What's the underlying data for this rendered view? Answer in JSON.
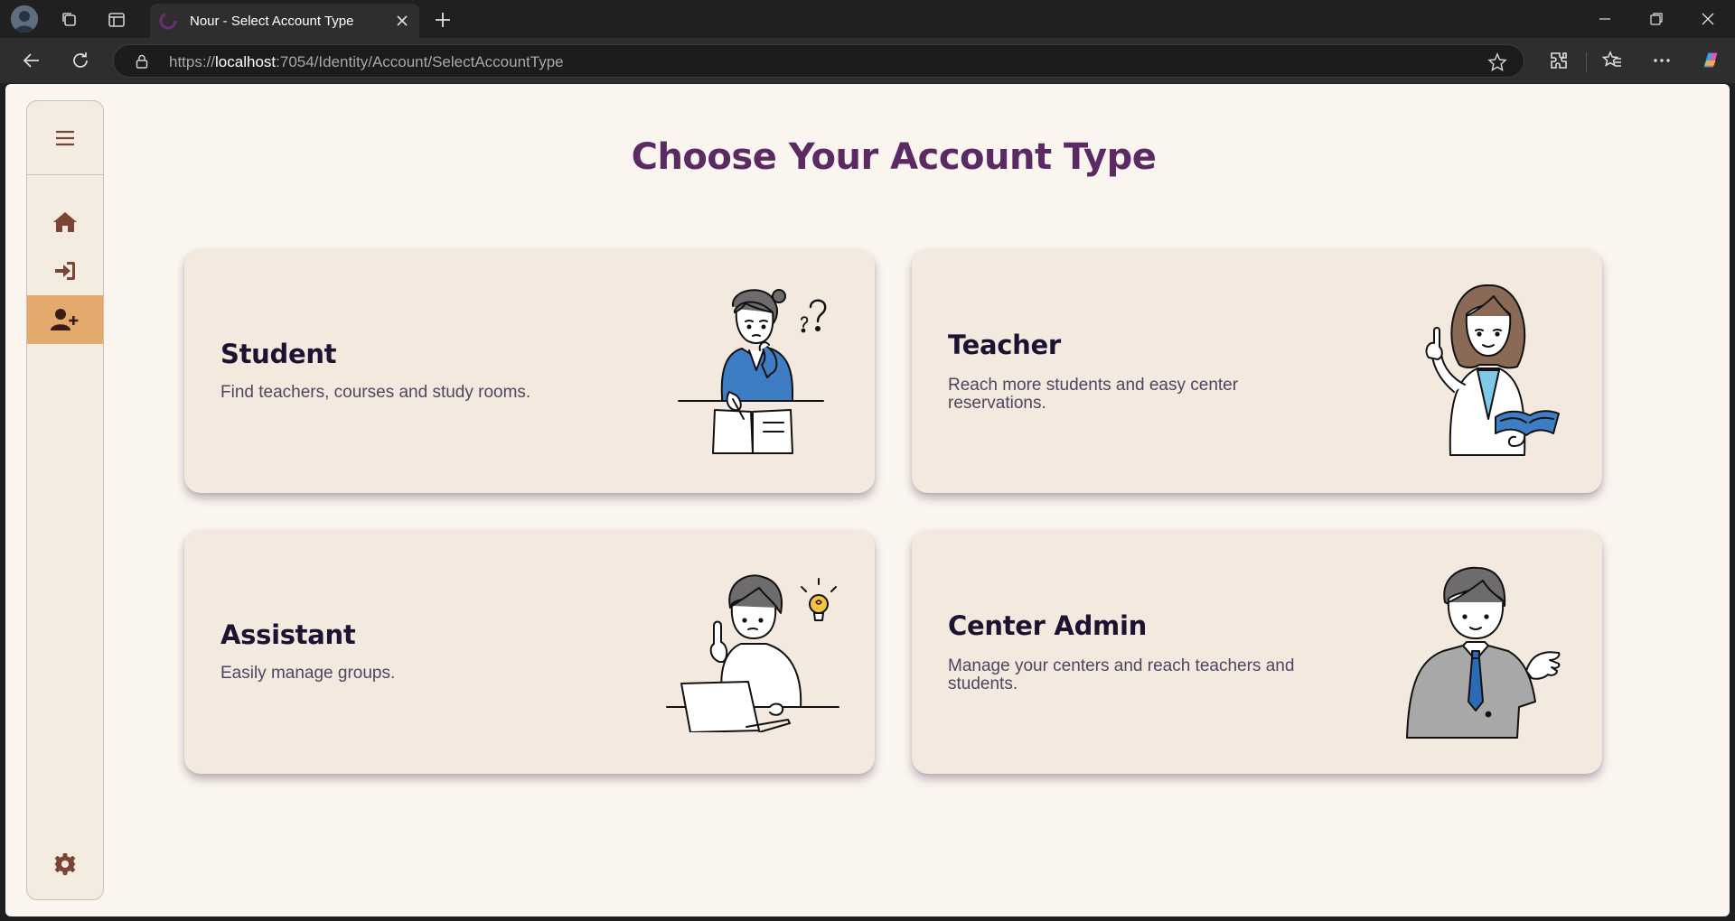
{
  "browser": {
    "tab_title": "Nour - Select Account Type",
    "url_prefix": "https://",
    "url_host": "localhost",
    "url_rest": ":7054/Identity/Account/SelectAccountType"
  },
  "page": {
    "title": "Choose Your Account Type"
  },
  "sidebar": {
    "items": [
      {
        "name": "home",
        "icon": "home-icon",
        "active": false
      },
      {
        "name": "login",
        "icon": "login-icon",
        "active": false
      },
      {
        "name": "register",
        "icon": "user-plus-icon",
        "active": true
      }
    ],
    "settings_icon": "gear-icon",
    "active_color": "#e4a96d"
  },
  "cards": [
    {
      "title": "Student",
      "description": "Find teachers, courses and study rooms.",
      "illustration": "student-illustration"
    },
    {
      "title": "Teacher",
      "description": "Reach more students and easy center reservations.",
      "illustration": "teacher-illustration"
    },
    {
      "title": "Assistant",
      "description": "Easily manage groups.",
      "illustration": "assistant-illustration"
    },
    {
      "title": "Center Admin",
      "description": "Manage your centers and reach teachers and students.",
      "illustration": "center-admin-illustration"
    }
  ],
  "colors": {
    "title": "#5b2a63",
    "card_bg": "#f4e9df",
    "page_bg": "#faf5ef",
    "icon_brown": "#7a4536"
  }
}
